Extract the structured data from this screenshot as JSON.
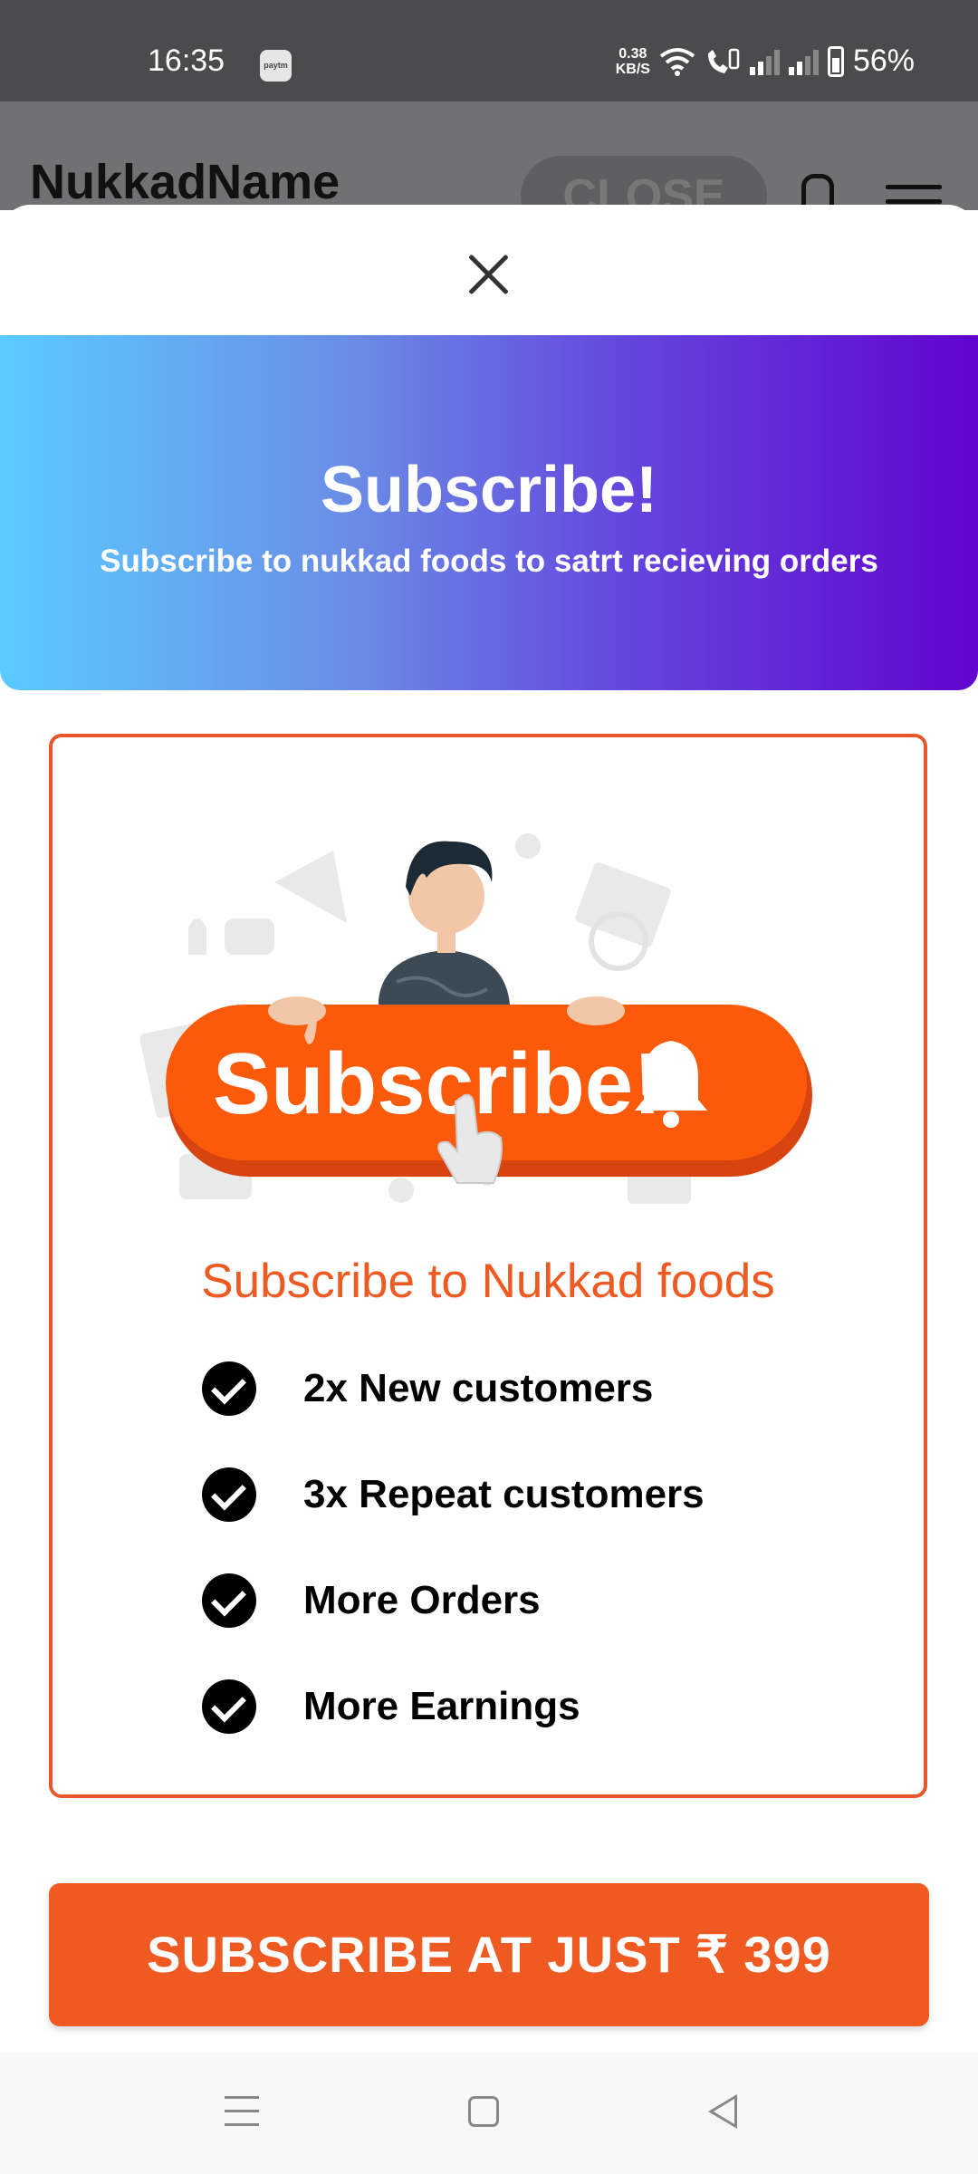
{
  "status_bar": {
    "time": "16:35",
    "paytm_label": "Paytm",
    "net_speed_value": "0.38",
    "net_speed_unit": "KB/S",
    "battery": "56%"
  },
  "background_page": {
    "title": "NukkadName",
    "close_label": "CLOSE"
  },
  "modal": {
    "banner_title": "Subscribe!",
    "banner_subtitle": "Subscribe to nukkad foods to satrt recieving orders",
    "illustration_text": "Subscribe!",
    "card_heading": "Subscribe to Nukkad foods",
    "features": [
      {
        "label": "2x New customers"
      },
      {
        "label": "3x Repeat customers"
      },
      {
        "label": "More Orders"
      },
      {
        "label": "More Earnings"
      }
    ],
    "cta_label": "SUBSCRIBE AT JUST ₹ 399"
  },
  "colors": {
    "accent": "#ef5a23",
    "gradient_start": "#5acbff",
    "gradient_end": "#6104cf"
  }
}
